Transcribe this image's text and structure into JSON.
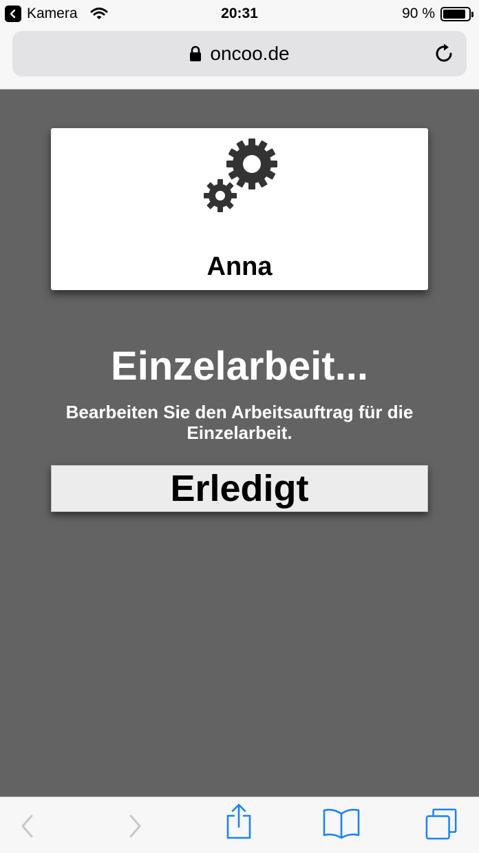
{
  "status_bar": {
    "back_app_label": "Kamera",
    "time": "20:31",
    "battery_percent": "90 %",
    "battery_level": 0.9
  },
  "browser": {
    "url": "oncoo.de"
  },
  "card": {
    "user_name": "Anna"
  },
  "main": {
    "phase_title": "Einzelarbeit...",
    "instruction": "Bearbeiten Sie den Arbeitsauftrag für die Einzelarbeit.",
    "done_label": "Erledigt"
  },
  "colors": {
    "content_bg": "#636363",
    "toolbar_accent": "#1a82fb",
    "toolbar_disabled": "#c7c7cc"
  },
  "toolbar": {
    "icons": [
      "back-icon",
      "forward-icon",
      "share-icon",
      "bookmarks-icon",
      "tabs-icon"
    ]
  }
}
